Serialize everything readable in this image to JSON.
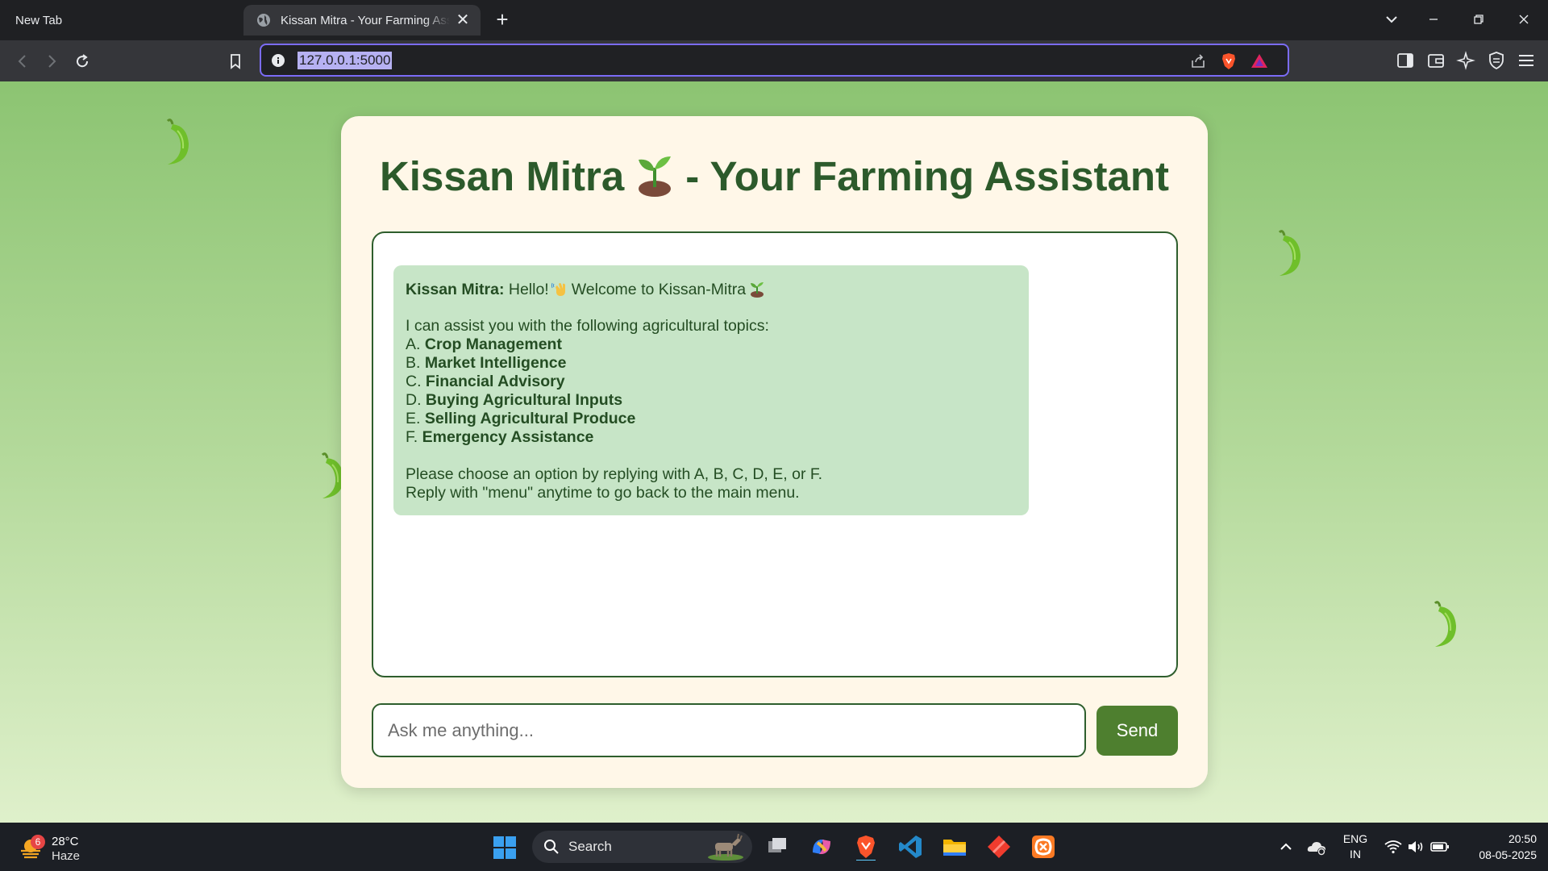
{
  "browser": {
    "tabs": [
      {
        "title": "New Tab",
        "active": false
      },
      {
        "title": "Kissan Mitra - Your Farming Assistant",
        "active": true
      }
    ],
    "url": "127.0.0.1:5000",
    "accent": "#7b6cf6"
  },
  "page": {
    "title_before": "Kissan Mitra",
    "title_after": "- Your Farming Assistant",
    "message": {
      "sender": "Kissan Mitra:",
      "greeting_1": "Hello!",
      "greeting_2": "Welcome to Kissan-Mitra",
      "intro": "I can assist you with the following agricultural topics:",
      "options": [
        {
          "key": "A.",
          "label": "Crop Management"
        },
        {
          "key": "B.",
          "label": "Market Intelligence"
        },
        {
          "key": "C.",
          "label": "Financial Advisory"
        },
        {
          "key": "D.",
          "label": "Buying Agricultural Inputs"
        },
        {
          "key": "E.",
          "label": "Selling Agricultural Produce"
        },
        {
          "key": "F.",
          "label": "Emergency Assistance"
        }
      ],
      "instruction": "Please choose an option by replying with A, B, C, D, E, or F.",
      "menu_hint": "Reply with \"menu\" anytime to go back to the main menu."
    },
    "input_placeholder": "Ask me anything...",
    "send_label": "Send",
    "colors": {
      "primary": "#2c5a2b",
      "bubble": "#c7e5c7",
      "button": "#4e7f2f",
      "card": "#fff7e8"
    }
  },
  "taskbar": {
    "weather_badge": "6",
    "temperature": "28°C",
    "condition": "Haze",
    "search_label": "Search",
    "lang_top": "ENG",
    "lang_bottom": "IN",
    "time": "20:50",
    "date": "08-05-2025"
  }
}
